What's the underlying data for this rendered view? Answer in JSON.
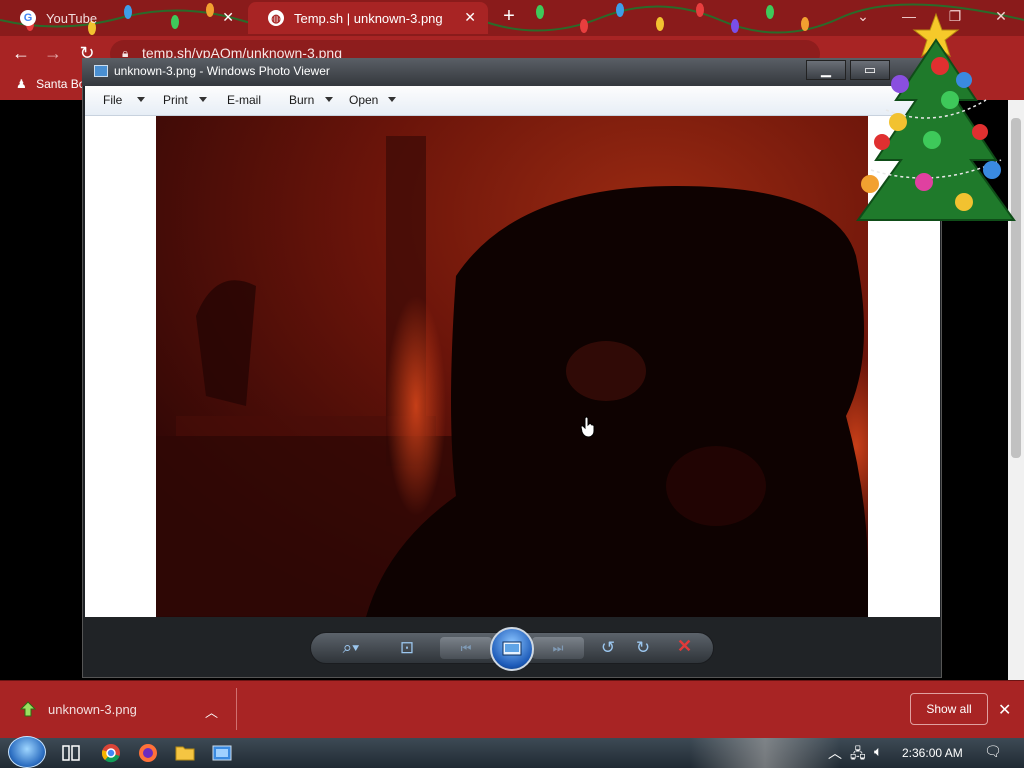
{
  "browser": {
    "tabs": [
      {
        "label": "YouTube",
        "icon": "google-icon",
        "active": false
      },
      {
        "label": "Temp.sh | unknown-3.png",
        "icon": "globe-icon",
        "active": true
      }
    ],
    "address": "temp.sh/vpAOm/unknown-3.png",
    "bookmark_label": "Santa Bo",
    "window_controls": [
      "chevron-down-icon",
      "minimize-icon",
      "maximize-icon",
      "close-icon"
    ]
  },
  "photo_viewer": {
    "title": "unknown-3.png - Windows Photo Viewer",
    "menu": [
      {
        "label": "File",
        "has_dropdown": true
      },
      {
        "label": "Print",
        "has_dropdown": true
      },
      {
        "label": "E-mail",
        "has_dropdown": false
      },
      {
        "label": "Burn",
        "has_dropdown": true
      },
      {
        "label": "Open",
        "has_dropdown": true
      }
    ],
    "controls": [
      "zoom-icon",
      "actual-size-icon",
      "previous-icon",
      "slideshow-icon",
      "next-icon",
      "rotate-counterclockwise-icon",
      "rotate-clockwise-icon",
      "delete-icon"
    ],
    "accent": "#1c5ab8"
  },
  "downloads": {
    "file_name": "unknown-3.png",
    "show_all_label": "Show all"
  },
  "taskbar": {
    "apps": [
      "start-orb-icon",
      "task-view-icon",
      "chrome-icon",
      "firefox-icon",
      "file-explorer-icon",
      "photo-viewer-icon"
    ],
    "clock": "2:36:00 AM"
  },
  "colors": {
    "browser_frame": "#a82424",
    "tab_strip": "#8a1b1b"
  }
}
